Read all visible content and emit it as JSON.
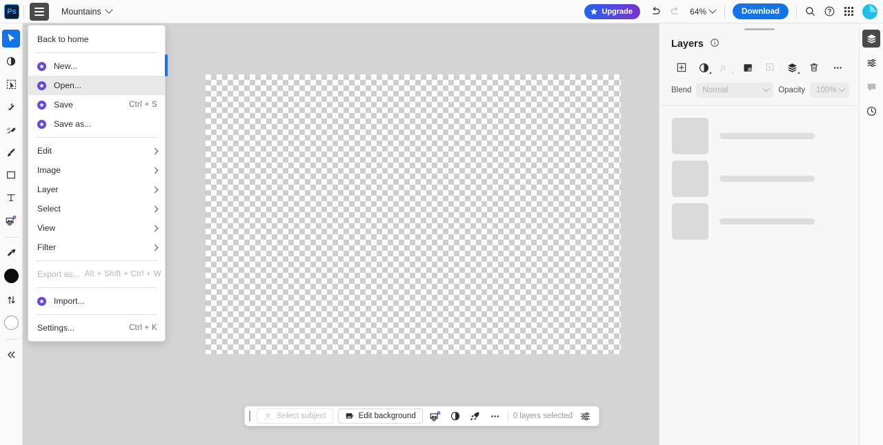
{
  "app": {
    "logo_text": "Ps",
    "document_title": "Mountains"
  },
  "topbar": {
    "menu_button": "menu-hamburger",
    "upgrade_label": "Upgrade",
    "undo_label": "Undo",
    "redo_label": "Redo",
    "zoom_level": "64%",
    "download_label": "Download",
    "search_label": "Search",
    "help_label": "Help",
    "apps_label": "Apps",
    "avatar_label": "Account"
  },
  "menu": {
    "items": [
      {
        "label": "Back to home",
        "icon": null,
        "shortcut": null,
        "type": "item",
        "highlighted": false,
        "disabled": false,
        "arrow": false
      },
      {
        "type": "separator"
      },
      {
        "label": "New...",
        "icon": "star-badge-icon",
        "shortcut": null,
        "type": "item",
        "highlighted": false,
        "disabled": false,
        "arrow": false
      },
      {
        "label": "Open...",
        "icon": "star-badge-icon",
        "shortcut": null,
        "type": "item",
        "highlighted": true,
        "disabled": false,
        "arrow": false
      },
      {
        "label": "Save",
        "icon": "star-badge-icon",
        "shortcut": "Ctrl + S",
        "type": "item",
        "highlighted": false,
        "disabled": false,
        "arrow": false
      },
      {
        "label": "Save as...",
        "icon": "star-badge-icon",
        "shortcut": null,
        "type": "item",
        "highlighted": false,
        "disabled": false,
        "arrow": false
      },
      {
        "type": "separator"
      },
      {
        "label": "Edit",
        "icon": null,
        "shortcut": null,
        "type": "item",
        "highlighted": false,
        "disabled": false,
        "arrow": true
      },
      {
        "label": "Image",
        "icon": null,
        "shortcut": null,
        "type": "item",
        "highlighted": false,
        "disabled": false,
        "arrow": true
      },
      {
        "label": "Layer",
        "icon": null,
        "shortcut": null,
        "type": "item",
        "highlighted": false,
        "disabled": false,
        "arrow": true
      },
      {
        "label": "Select",
        "icon": null,
        "shortcut": null,
        "type": "item",
        "highlighted": false,
        "disabled": false,
        "arrow": true
      },
      {
        "label": "View",
        "icon": null,
        "shortcut": null,
        "type": "item",
        "highlighted": false,
        "disabled": false,
        "arrow": true
      },
      {
        "label": "Filter",
        "icon": null,
        "shortcut": null,
        "type": "item",
        "highlighted": false,
        "disabled": false,
        "arrow": true
      },
      {
        "type": "separator"
      },
      {
        "label": "Export as...",
        "icon": null,
        "shortcut": "Alt + Shift + Ctrl + W",
        "type": "item",
        "highlighted": false,
        "disabled": true,
        "arrow": false
      },
      {
        "type": "separator"
      },
      {
        "label": "Import...",
        "icon": "star-badge-icon",
        "shortcut": null,
        "type": "item",
        "highlighted": false,
        "disabled": false,
        "arrow": false
      },
      {
        "type": "separator"
      },
      {
        "label": "Settings...",
        "icon": null,
        "shortcut": "Ctrl + K",
        "type": "item",
        "highlighted": false,
        "disabled": false,
        "arrow": false
      }
    ]
  },
  "toolbar": {
    "tools": [
      {
        "name": "move-tool",
        "icon": "cursor-arrow-icon",
        "active": true
      },
      {
        "name": "adjustments-tool",
        "icon": "half-circle-icon",
        "active": false
      },
      {
        "name": "object-select-tool",
        "icon": "marquee-select-icon",
        "active": false
      },
      {
        "name": "quick-select-tool",
        "icon": "magic-wand-icon",
        "active": false
      },
      {
        "name": "spot-heal-tool",
        "icon": "spot-heal-icon",
        "active": false
      },
      {
        "name": "brush-tool",
        "icon": "paintbrush-icon",
        "active": false
      },
      {
        "name": "shape-tool",
        "icon": "rectangle-icon",
        "active": false
      },
      {
        "name": "type-tool",
        "icon": "text-t-icon",
        "active": false
      },
      {
        "name": "generative-fill-tool",
        "icon": "image-plus-sparkle-icon",
        "active": false
      },
      {
        "name": "separator",
        "icon": "divider",
        "active": false
      },
      {
        "name": "eyedropper-tool",
        "icon": "eyedropper-icon",
        "active": false
      },
      {
        "name": "foreground-color",
        "icon": "color-swatch-black",
        "active": false
      },
      {
        "name": "swap-colors",
        "icon": "swap-arrows-icon",
        "active": false
      },
      {
        "name": "background-color",
        "icon": "color-swatch-white",
        "active": false
      },
      {
        "name": "separator",
        "icon": "divider",
        "active": false
      },
      {
        "name": "collapse-toolbar",
        "icon": "double-chevron-left-icon",
        "active": false
      }
    ]
  },
  "context_bar": {
    "select_subject_label": "Select subject",
    "select_subject_disabled": true,
    "edit_background_label": "Edit background",
    "icons": [
      {
        "name": "generative-fill-icon"
      },
      {
        "name": "adjustment-icon"
      },
      {
        "name": "rocket-icon"
      },
      {
        "name": "more-options-icon"
      }
    ],
    "status_text": "0 layers selected",
    "settings_label": "Properties"
  },
  "layers_panel": {
    "title": "Layers",
    "info_icon": "info-circle-icon",
    "tools": [
      {
        "name": "add-layer-button",
        "icon": "plus-square-icon",
        "disabled": false,
        "caret": false
      },
      {
        "name": "adjustment-layer-button",
        "icon": "half-circle-icon",
        "disabled": false,
        "caret": true
      },
      {
        "name": "layer-effects-button",
        "icon": "fx-icon",
        "disabled": true,
        "caret": true
      },
      {
        "name": "layer-mask-button",
        "icon": "mask-icon",
        "disabled": false,
        "caret": false
      },
      {
        "name": "clipping-mask-button",
        "icon": "clipping-mask-icon",
        "disabled": true,
        "caret": false
      },
      {
        "name": "group-layers-button",
        "icon": "stack-icon",
        "disabled": false,
        "caret": true
      },
      {
        "name": "delete-layer-button",
        "icon": "trash-icon",
        "disabled": false,
        "caret": false
      },
      {
        "name": "more-options-button",
        "icon": "more-options-icon",
        "disabled": false,
        "caret": false
      }
    ],
    "blend_label": "Blend",
    "blend_value": "Normal",
    "opacity_label": "Opacity",
    "opacity_value": "100%",
    "skeleton_rows": 3
  },
  "right_rail": {
    "items": [
      {
        "name": "rail-layers",
        "icon": "layers-stack-icon",
        "active": true
      },
      {
        "name": "rail-properties",
        "icon": "sliders-icon",
        "active": false
      },
      {
        "name": "rail-comments",
        "icon": "comment-bubble-icon",
        "active": false
      },
      {
        "name": "rail-history",
        "icon": "history-clock-icon",
        "active": false
      }
    ]
  },
  "colors": {
    "accent_blue": "#1473e6",
    "upgrade_gradient_start": "#2563eb",
    "upgrade_gradient_end": "#7a32d0",
    "workarea_bg": "#d4d4d4",
    "panel_bg": "#f7f7f7",
    "foreground_swatch": "#0d0d0d",
    "background_swatch": "#ffffff"
  }
}
